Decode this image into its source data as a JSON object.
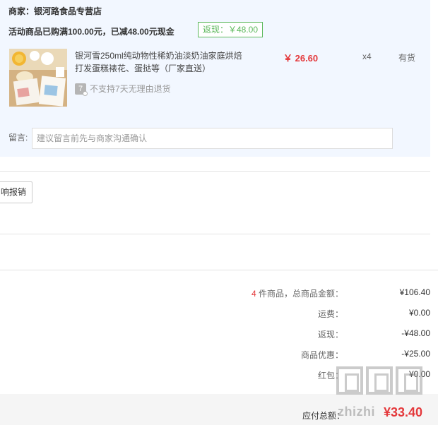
{
  "shop": {
    "merchant": "商家：银河路食品专营店",
    "promo": "活动商品已购满100.00元，已减48.00元现金",
    "cashback_badge": "返现：￥48.00"
  },
  "product": {
    "title": "银河雪250ml纯动物性稀奶油淡奶油家庭烘焙打发蛋糕裱花、蛋挞等（厂家直送）",
    "price": "￥ 26.60",
    "quantity": "x4",
    "stock": "有货",
    "return_icon": "7",
    "return_policy": "不支持7天无理由退货"
  },
  "message": {
    "label": "留言:",
    "placeholder": "建议留言前先与商家沟通确认"
  },
  "report_button": "响报销",
  "summary": {
    "items_count": "4",
    "items_label": " 件商品，总商品金额：",
    "items_total": "¥106.40",
    "shipping_label": "运费：",
    "shipping_value": "¥0.00",
    "cashback_label": "返现：",
    "cashback_value": "-¥48.00",
    "discount_label": "商品优惠：",
    "discount_value": "-¥25.00",
    "redpacket_label": "红包：",
    "redpacket_value": "¥0.00",
    "payable_label": "应付总额：",
    "payable_value": "¥33.40"
  },
  "watermark": {
    "text": "zhizhi"
  },
  "colors": {
    "accent_red": "#e4393c",
    "cashback_green": "#5cb85c",
    "panel_bg": "#f2f7ff"
  }
}
